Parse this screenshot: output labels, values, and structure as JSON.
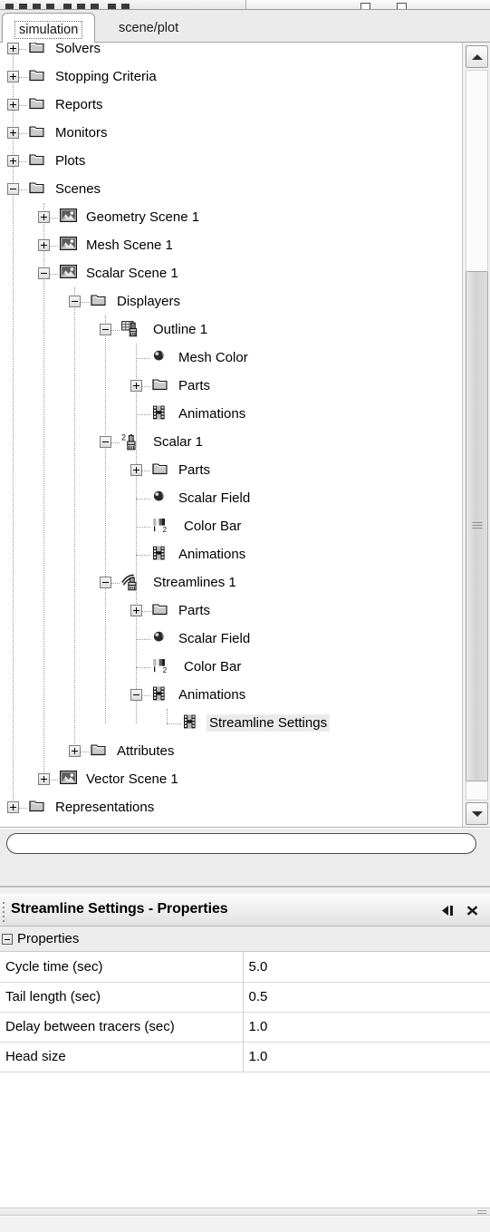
{
  "tabs": [
    {
      "label": "simulation",
      "active": true
    },
    {
      "label": "scene/plot",
      "active": false
    }
  ],
  "tree": {
    "nodes": [
      {
        "label": "Solvers",
        "depth": 0,
        "icon": "folder-icon",
        "expander": "plus",
        "clipped": true,
        "selected": false
      },
      {
        "label": "Stopping Criteria",
        "depth": 0,
        "icon": "folder-icon",
        "expander": "plus",
        "clipped": false,
        "selected": false
      },
      {
        "label": "Reports",
        "depth": 0,
        "icon": "folder-icon",
        "expander": "plus",
        "clipped": false,
        "selected": false
      },
      {
        "label": "Monitors",
        "depth": 0,
        "icon": "folder-icon",
        "expander": "plus",
        "clipped": false,
        "selected": false
      },
      {
        "label": "Plots",
        "depth": 0,
        "icon": "folder-icon",
        "expander": "plus",
        "clipped": false,
        "selected": false
      },
      {
        "label": "Scenes",
        "depth": 0,
        "icon": "folder-icon",
        "expander": "minus",
        "clipped": false,
        "selected": false
      },
      {
        "label": "Geometry Scene 1",
        "depth": 1,
        "icon": "scene-icon",
        "expander": "plus",
        "clipped": false,
        "selected": false
      },
      {
        "label": "Mesh Scene 1",
        "depth": 1,
        "icon": "scene-icon",
        "expander": "plus",
        "clipped": false,
        "selected": false
      },
      {
        "label": "Scalar Scene 1",
        "depth": 1,
        "icon": "scene-icon",
        "expander": "minus",
        "clipped": false,
        "selected": false
      },
      {
        "label": "Displayers",
        "depth": 2,
        "icon": "folder-icon",
        "expander": "minus",
        "clipped": false,
        "selected": false
      },
      {
        "label": "Outline 1",
        "depth": 3,
        "icon": "outline-icon",
        "expander": "minus",
        "clipped": false,
        "selected": false
      },
      {
        "label": "Mesh Color",
        "depth": 4,
        "icon": "sphere-icon",
        "expander": "none",
        "clipped": false,
        "selected": false
      },
      {
        "label": "Parts",
        "depth": 4,
        "icon": "folder-icon",
        "expander": "plus",
        "clipped": false,
        "selected": false
      },
      {
        "label": "Animations",
        "depth": 4,
        "icon": "film-icon",
        "expander": "none",
        "clipped": false,
        "selected": false
      },
      {
        "label": "Scalar 1",
        "depth": 3,
        "icon": "scalar-icon",
        "expander": "minus",
        "clipped": false,
        "selected": false
      },
      {
        "label": "Parts",
        "depth": 4,
        "icon": "folder-icon",
        "expander": "plus",
        "clipped": false,
        "selected": false
      },
      {
        "label": "Scalar Field",
        "depth": 4,
        "icon": "sphere-icon",
        "expander": "none",
        "clipped": false,
        "selected": false
      },
      {
        "label": "Color Bar",
        "depth": 4,
        "icon": "colorbar-icon",
        "expander": "none",
        "clipped": false,
        "selected": false
      },
      {
        "label": "Animations",
        "depth": 4,
        "icon": "film-icon",
        "expander": "none",
        "clipped": false,
        "selected": false
      },
      {
        "label": "Streamlines 1",
        "depth": 3,
        "icon": "streamlines-icon",
        "expander": "minus",
        "clipped": false,
        "selected": false
      },
      {
        "label": "Parts",
        "depth": 4,
        "icon": "folder-icon",
        "expander": "plus",
        "clipped": false,
        "selected": false
      },
      {
        "label": "Scalar Field",
        "depth": 4,
        "icon": "sphere-icon",
        "expander": "none",
        "clipped": false,
        "selected": false
      },
      {
        "label": "Color Bar",
        "depth": 4,
        "icon": "colorbar-icon",
        "expander": "none",
        "clipped": false,
        "selected": false
      },
      {
        "label": "Animations",
        "depth": 4,
        "icon": "film-icon",
        "expander": "minus",
        "clipped": false,
        "selected": false
      },
      {
        "label": "Streamline Settings",
        "depth": 5,
        "icon": "film-icon",
        "expander": "none",
        "clipped": false,
        "selected": true
      },
      {
        "label": "Attributes",
        "depth": 2,
        "icon": "folder-icon",
        "expander": "plus",
        "clipped": false,
        "selected": false
      },
      {
        "label": "Vector Scene 1",
        "depth": 1,
        "icon": "scene-icon",
        "expander": "plus",
        "clipped": false,
        "selected": false
      },
      {
        "label": "Representations",
        "depth": 0,
        "icon": "folder-icon",
        "expander": "plus",
        "clipped": false,
        "selected": false
      }
    ],
    "scrollbar": {
      "up_icon": "chevron-up-icon",
      "down_icon": "chevron-down-icon",
      "thumb_grip_icon": "grip-lines-icon"
    }
  },
  "filter": {
    "value": "",
    "placeholder": ""
  },
  "properties_window": {
    "title_object": "Streamline Settings",
    "title_separator": "-",
    "title_suffix": "Properties",
    "minimize_icon": "collapse-left-icon",
    "close_icon": "close-icon",
    "section_label": "Properties",
    "rows": [
      {
        "key": "Cycle time (sec)",
        "value": "5.0"
      },
      {
        "key": "Tail length (sec)",
        "value": "0.5"
      },
      {
        "key": "Delay between tracers (sec)",
        "value": "1.0"
      },
      {
        "key": "Head size",
        "value": "1.0"
      }
    ]
  }
}
